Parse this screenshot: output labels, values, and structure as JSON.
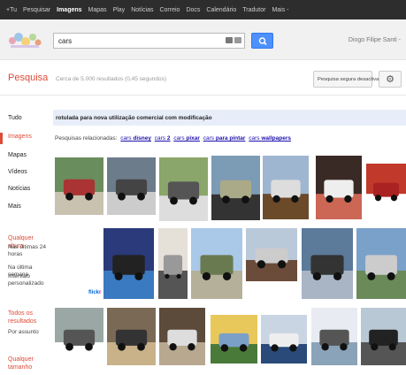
{
  "topbar": {
    "items": [
      "+Tu",
      "Pesquisar",
      "Imagens",
      "Mapas",
      "Play",
      "Notícias",
      "Correio",
      "Docs",
      "Calendário",
      "Tradutor",
      "Mais -"
    ],
    "active_index": 2
  },
  "search": {
    "query": "cars"
  },
  "user": {
    "name": "Diogo Filipe Santi -"
  },
  "subheader": {
    "title": "Pesquisa",
    "stats": "Cerca de 5.000 resultados (0,45 segundos)",
    "safesearch": "Pesquisa segura desactivada -"
  },
  "nav": {
    "items": [
      "Tudo",
      "Imagens",
      "Mapas",
      "Vídeos",
      "Notícias",
      "Mais"
    ],
    "active_index": 1
  },
  "filters": {
    "size_title": "Qualquer altura",
    "time_items": [
      "Nas últimas 24 horas",
      "Na última semana",
      "Intervalo personalizado"
    ],
    "results_title": "Todos os resultados",
    "by_subject": "Por assunto",
    "size2_title": "Qualquer tamanho"
  },
  "license_bar": "rotulada para nova utilização comercial com modificação",
  "related": {
    "label": "Pesquisas relacionadas:",
    "links": [
      {
        "plain": "cars ",
        "bold": "disney"
      },
      {
        "plain": "cars ",
        "bold": "2"
      },
      {
        "plain": "cars ",
        "bold": "pixar"
      },
      {
        "plain": "cars ",
        "bold": "para pintar"
      },
      {
        "plain": "cars ",
        "bold": "wallpapers"
      }
    ]
  },
  "flickr": {
    "logo_a": "flick",
    "logo_b": "r"
  },
  "colors": {
    "accent_red": "#dd4b39",
    "search_blue": "#4d90fe",
    "topbar_bg": "#2d2d2d",
    "link_blue": "#1a0dab"
  }
}
